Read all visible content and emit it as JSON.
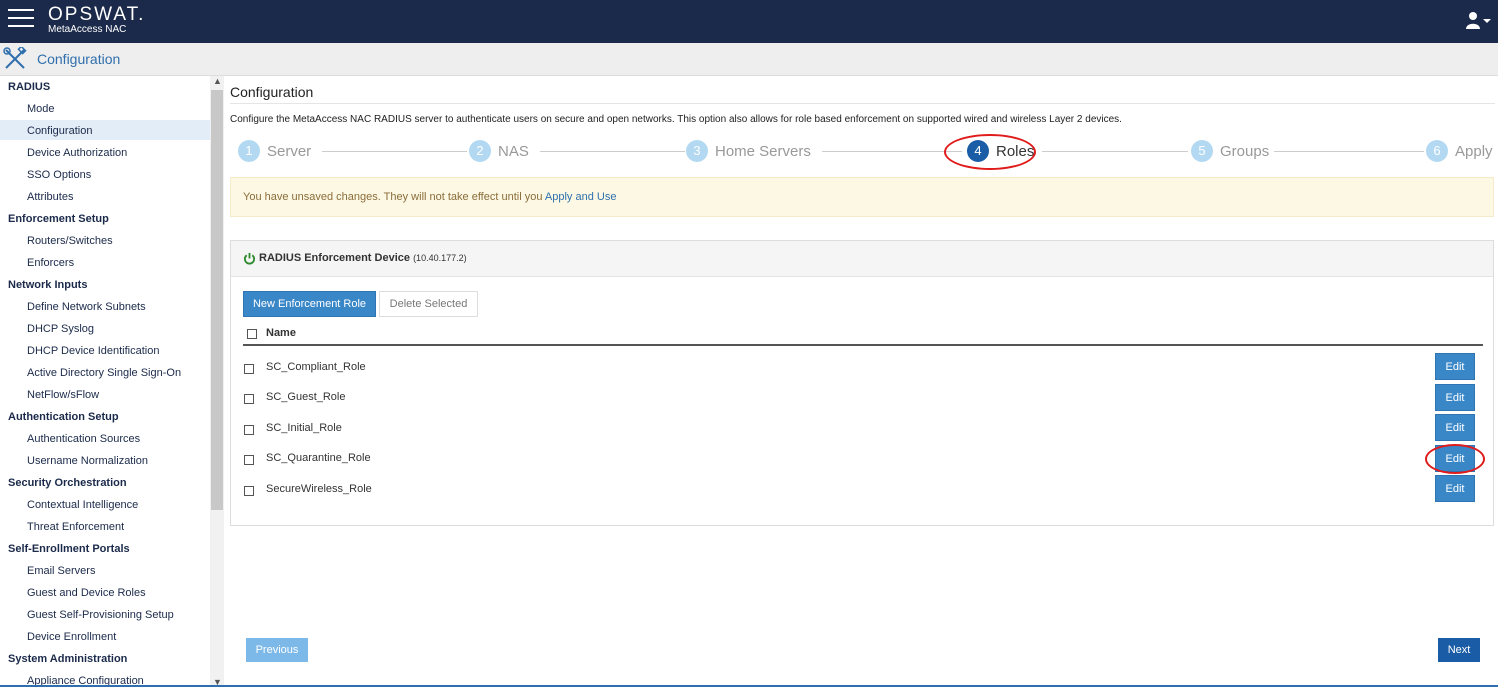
{
  "header": {
    "brand": "OPSWAT.",
    "product": "MetaAccess NAC"
  },
  "configbar": {
    "title": "Configuration"
  },
  "sidebar": {
    "sections": [
      {
        "title": "RADIUS",
        "items": [
          "Mode",
          "Configuration",
          "Device Authorization",
          "SSO Options",
          "Attributes"
        ]
      },
      {
        "title": "Enforcement Setup",
        "items": [
          "Routers/Switches",
          "Enforcers"
        ]
      },
      {
        "title": "Network Inputs",
        "items": [
          "Define Network Subnets",
          "DHCP Syslog",
          "DHCP Device Identification",
          "Active Directory Single Sign-On",
          "NetFlow/sFlow"
        ]
      },
      {
        "title": "Authentication Setup",
        "items": [
          "Authentication Sources",
          "Username Normalization"
        ]
      },
      {
        "title": "Security Orchestration",
        "items": [
          "Contextual Intelligence",
          "Threat Enforcement"
        ]
      },
      {
        "title": "Self-Enrollment Portals",
        "items": [
          "Email Servers",
          "Guest and Device Roles",
          "Guest Self-Provisioning Setup",
          "Device Enrollment"
        ]
      },
      {
        "title": "System Administration",
        "items": [
          "Appliance Configuration"
        ]
      }
    ],
    "active_item": "Configuration"
  },
  "main": {
    "title": "Configuration",
    "description": "Configure the MetaAccess NAC RADIUS server to authenticate users on secure and open networks. This option also allows for role based enforcement on supported wired and wireless Layer 2 devices.",
    "wizard": [
      {
        "num": "1",
        "label": "Server"
      },
      {
        "num": "2",
        "label": "NAS"
      },
      {
        "num": "3",
        "label": "Home Servers"
      },
      {
        "num": "4",
        "label": "Roles",
        "active": true
      },
      {
        "num": "5",
        "label": "Groups"
      },
      {
        "num": "6",
        "label": "Apply"
      }
    ],
    "alert": {
      "text": "You have unsaved changes. They will not take effect until you",
      "link": "Apply and Use"
    },
    "panel": {
      "title": "RADIUS Enforcement Device",
      "subtitle": "(10.40.177.2)",
      "new_button": "New Enforcement Role",
      "delete_button": "Delete Selected",
      "column_name": "Name",
      "rows": [
        {
          "name": "SC_Compliant_Role",
          "edit": "Edit"
        },
        {
          "name": "SC_Guest_Role",
          "edit": "Edit"
        },
        {
          "name": "SC_Initial_Role",
          "edit": "Edit"
        },
        {
          "name": "SC_Quarantine_Role",
          "edit": "Edit"
        },
        {
          "name": "SecureWireless_Role",
          "edit": "Edit"
        }
      ]
    },
    "previous_button": "Previous",
    "next_button": "Next"
  },
  "colors": {
    "topbar": "#1b2a4a",
    "accent": "#3a87c8",
    "active_step": "#1a5da6",
    "highlight": "#e01b1b"
  }
}
